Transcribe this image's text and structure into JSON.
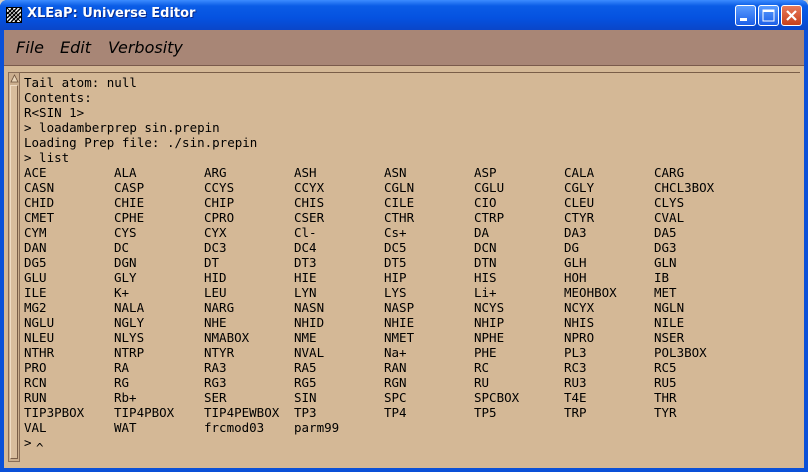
{
  "window": {
    "title": "XLEaP: Universe Editor",
    "accent": "#0a50d8"
  },
  "menu": {
    "items": [
      "File",
      "Edit",
      "Verbosity"
    ]
  },
  "terminal": {
    "background": "#d4b896",
    "header_lines": [
      "Tail atom: null",
      "Contents:",
      "R<SIN 1>",
      "> loadamberprep sin.prepin",
      "Loading Prep file: ./sin.prepin",
      "> list"
    ],
    "list_rows": [
      [
        "ACE",
        "ALA",
        "ARG",
        "ASH",
        "ASN",
        "ASP",
        "CALA",
        "CARG"
      ],
      [
        "CASN",
        "CASP",
        "CCYS",
        "CCYX",
        "CGLN",
        "CGLU",
        "CGLY",
        "CHCL3BOX"
      ],
      [
        "CHID",
        "CHIE",
        "CHIP",
        "CHIS",
        "CILE",
        "CIO",
        "CLEU",
        "CLYS"
      ],
      [
        "CMET",
        "CPHE",
        "CPRO",
        "CSER",
        "CTHR",
        "CTRP",
        "CTYR",
        "CVAL"
      ],
      [
        "CYM",
        "CYS",
        "CYX",
        "Cl-",
        "Cs+",
        "DA",
        "DA3",
        "DA5"
      ],
      [
        "DAN",
        "DC",
        "DC3",
        "DC4",
        "DC5",
        "DCN",
        "DG",
        "DG3"
      ],
      [
        "DG5",
        "DGN",
        "DT",
        "DT3",
        "DT5",
        "DTN",
        "GLH",
        "GLN"
      ],
      [
        "GLU",
        "GLY",
        "HID",
        "HIE",
        "HIP",
        "HIS",
        "HOH",
        "IB"
      ],
      [
        "ILE",
        "K+",
        "LEU",
        "LYN",
        "LYS",
        "Li+",
        "MEOHBOX",
        "MET"
      ],
      [
        "MG2",
        "NALA",
        "NARG",
        "NASN",
        "NASP",
        "NCYS",
        "NCYX",
        "NGLN"
      ],
      [
        "NGLU",
        "NGLY",
        "NHE",
        "NHID",
        "NHIE",
        "NHIP",
        "NHIS",
        "NILE"
      ],
      [
        "NLEU",
        "NLYS",
        "NMABOX",
        "NME",
        "NMET",
        "NPHE",
        "NPRO",
        "NSER"
      ],
      [
        "NTHR",
        "NTRP",
        "NTYR",
        "NVAL",
        "Na+",
        "PHE",
        "PL3",
        "POL3BOX"
      ],
      [
        "PRO",
        "RA",
        "RA3",
        "RA5",
        "RAN",
        "RC",
        "RC3",
        "RC5"
      ],
      [
        "RCN",
        "RG",
        "RG3",
        "RG5",
        "RGN",
        "RU",
        "RU3",
        "RU5"
      ],
      [
        "RUN",
        "Rb+",
        "SER",
        "SIN",
        "SPC",
        "SPCBOX",
        "T4E",
        "THR"
      ],
      [
        "TIP3PBOX",
        "TIP4PBOX",
        "TIP4PEWBOX",
        "TP3",
        "TP4",
        "TP5",
        "TRP",
        "TYR"
      ],
      [
        "VAL",
        "WAT",
        "frcmod03",
        "parm99"
      ]
    ],
    "prompt": ">",
    "cursor": "^"
  }
}
